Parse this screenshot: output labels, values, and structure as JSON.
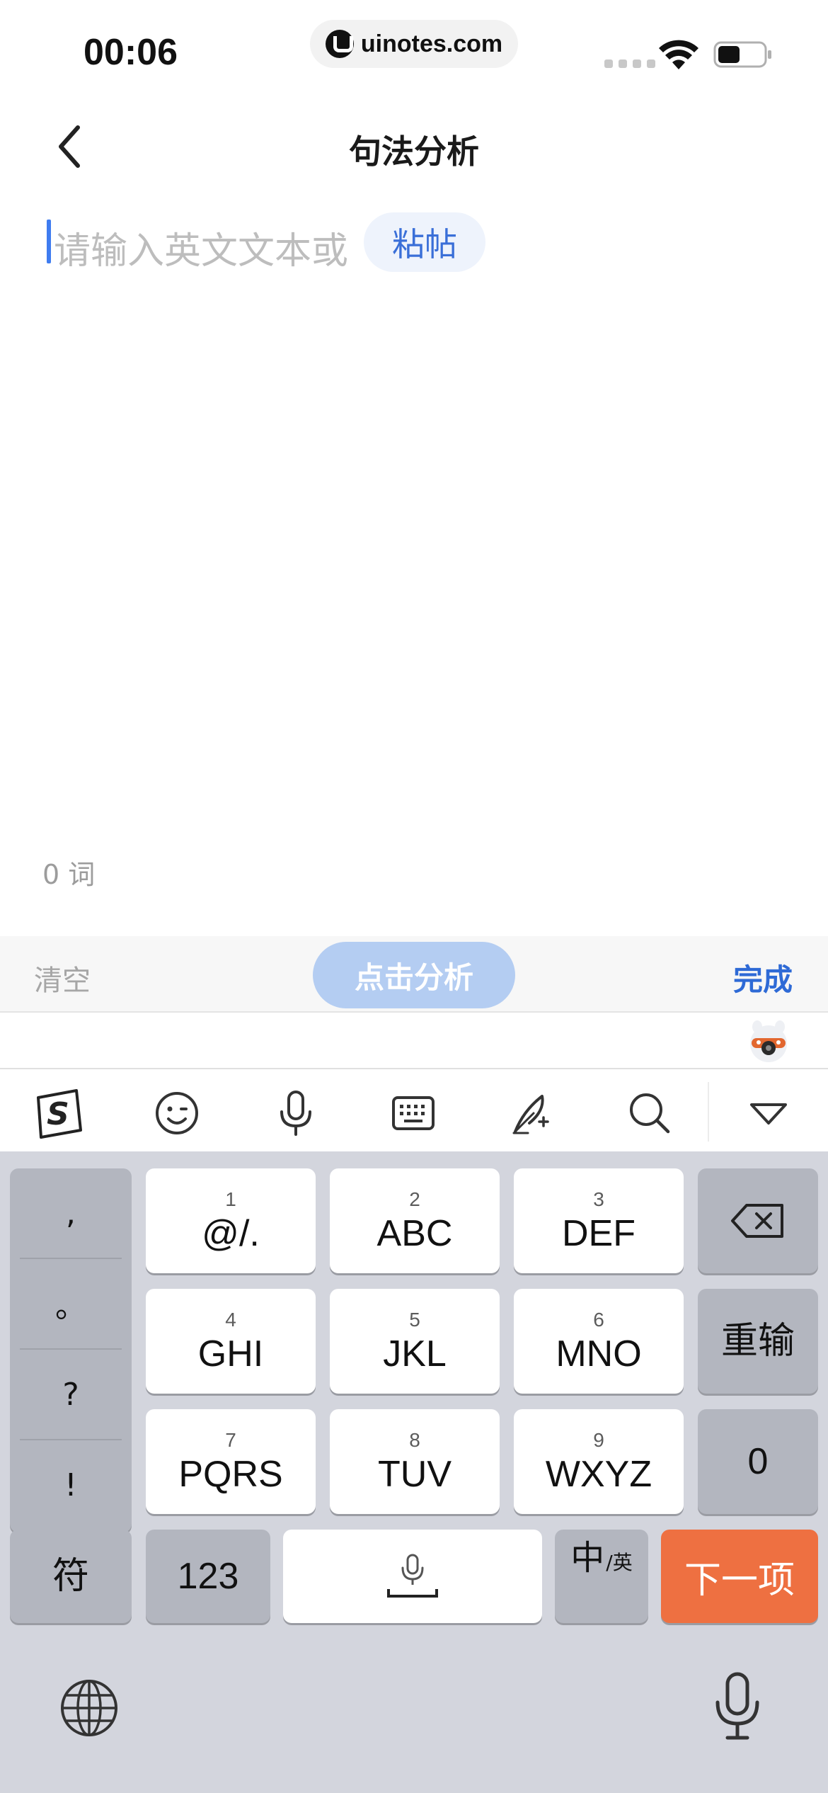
{
  "status_bar": {
    "time": "00:06",
    "url": "uinotes.com"
  },
  "header": {
    "title": "句法分析"
  },
  "editor": {
    "placeholder": "请输入英文文本或",
    "paste_label": "粘帖",
    "word_count": "0 词"
  },
  "action_bar": {
    "clear_label": "清空",
    "analyze_label": "点击分析",
    "done_label": "完成"
  },
  "keyboard": {
    "punctuation": [
      ",",
      "。",
      "?",
      "!"
    ],
    "t9_keys": [
      {
        "num": "1",
        "label": "@/."
      },
      {
        "num": "2",
        "label": "ABC"
      },
      {
        "num": "3",
        "label": "DEF"
      },
      {
        "num": "4",
        "label": "GHI"
      },
      {
        "num": "5",
        "label": "JKL"
      },
      {
        "num": "6",
        "label": "MNO"
      },
      {
        "num": "7",
        "label": "PQRS"
      },
      {
        "num": "8",
        "label": "TUV"
      },
      {
        "num": "9",
        "label": "WXYZ"
      }
    ],
    "reinput_label": "重输",
    "zero_label": "0",
    "symbol_label": "符",
    "numbers_label": "123",
    "lang_main": "中",
    "lang_sub": "/英",
    "next_label": "下一项",
    "accent_color": "#ee7041"
  },
  "colors": {
    "link_blue": "#2e6ad6",
    "analyze_button_bg": "#b4cdf2",
    "keyboard_bg": "#d3d5dd"
  }
}
